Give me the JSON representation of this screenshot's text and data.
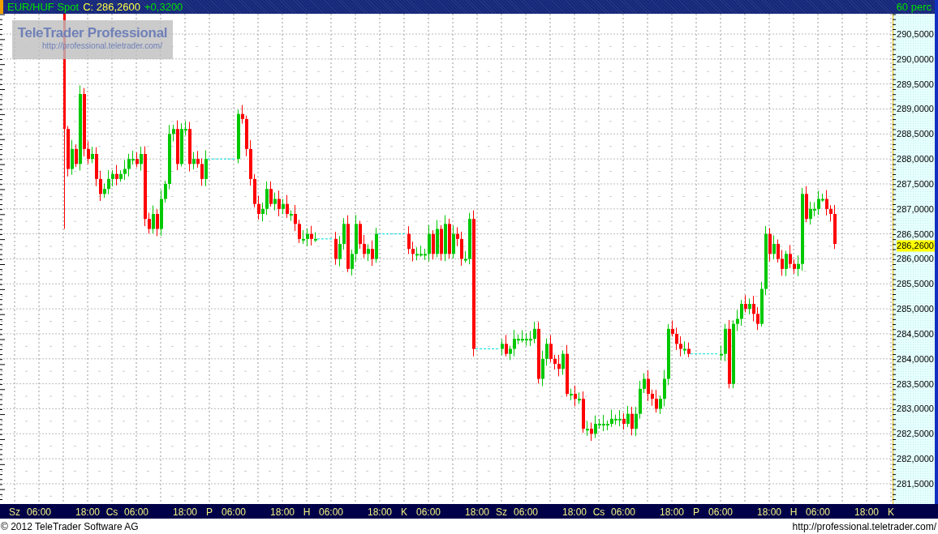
{
  "header": {
    "symbol": "EUR/HUF Spot",
    "close": "C: 286,2600",
    "change": "+0,3200",
    "interval": "60 perc"
  },
  "logo": {
    "title": "TeleTrader Professional",
    "url": "http://professional.teletrader.com/"
  },
  "y_axis": {
    "labels": [
      "290,5000",
      "290,0000",
      "289,5000",
      "289,0000",
      "288,5000",
      "288,0000",
      "287,5000",
      "287,0000",
      "286,5000",
      "286,0000",
      "285,5000",
      "285,0000",
      "284,5000",
      "284,0000",
      "283,5000",
      "283,0000",
      "282,5000",
      "282,0000",
      "281,5000"
    ],
    "current_price": "286,2600"
  },
  "x_axis": {
    "labels": [
      "Sz",
      "06:00",
      "18:00",
      "Cs",
      "06:00",
      "18:00",
      "P",
      "06:00",
      "18:00",
      "H",
      "06:00",
      "18:00",
      "K",
      "06:00",
      "18:00",
      "Sz",
      "06:00",
      "18:00",
      "Cs",
      "06:00",
      "18:00",
      "P",
      "06:00",
      "18:00",
      "H",
      "06:00",
      "18:00",
      "K"
    ]
  },
  "footer": {
    "copyright": "© 2012 TeleTrader Software AG",
    "url": "http://professional.teletrader.com/"
  }
}
